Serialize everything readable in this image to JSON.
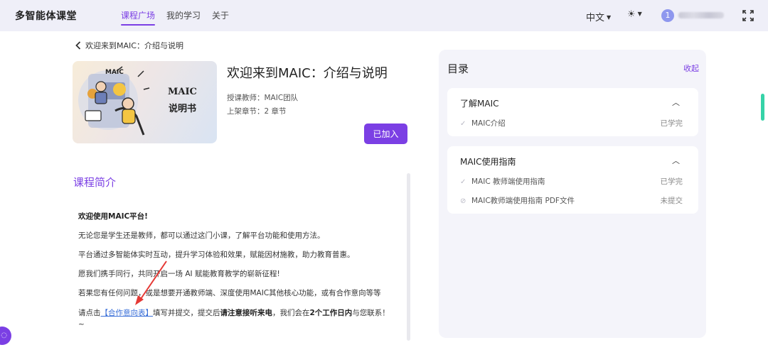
{
  "brand": "多智能体课堂",
  "nav": {
    "items": [
      "课程广场",
      "我的学习",
      "关于"
    ],
    "active": 0
  },
  "header": {
    "language": "中文",
    "avatar_initial": "1"
  },
  "back": {
    "label": "欢迎来到MAIC：介绍与说明"
  },
  "course": {
    "cover_line1": "MAIC",
    "cover_line2": "说明书",
    "title": "欢迎来到MAIC：介绍与说明",
    "teacher": "授课教师：MAIC团队",
    "chapters": "上架章节：2 章节",
    "join_label": "已加入"
  },
  "intro": {
    "heading": "课程简介",
    "welcome": "欢迎使用MAIC平台!",
    "p1": "无论您是学生还是教师，都可以通过这门小课，了解平台功能和使用方法。",
    "p2": "平台通过多智能体实时互动，提升学习体验和效果，赋能因材施教，助力教育普惠。",
    "p3": "愿我们携手同行，共同开启一场 AI 赋能教育教学的崭新征程!",
    "p4": "若果您有任何问题，或是想要开通教师端、深度使用MAIC其他核心功能，或有合作意向等等",
    "p5_pre": "请点击",
    "p5_link": "【合作意向表】",
    "p5_mid": "填写并提交，提交后",
    "p5_bold1": "请注意接听来电",
    "p5_mid2": "，我们会在",
    "p5_bold2": "2个工作日内",
    "p5_end": "与您联系！~"
  },
  "catalog": {
    "title": "目录",
    "collapse_label": "收起",
    "chapters": [
      {
        "title": "了解MAIC",
        "lessons": [
          {
            "icon": "check-icon",
            "name": "MAIC介绍",
            "status": "已学完"
          }
        ]
      },
      {
        "title": "MAIC使用指南",
        "lessons": [
          {
            "icon": "check-icon",
            "name": "MAIC 教师端使用指南",
            "status": "已学完"
          },
          {
            "icon": "document-icon",
            "name": "MAIC教师端使用指南 PDF文件",
            "status": "未提交"
          }
        ]
      }
    ]
  },
  "colors": {
    "accent": "#7b3fe4",
    "link": "#3a6fd8",
    "annotation": "#e53935"
  }
}
